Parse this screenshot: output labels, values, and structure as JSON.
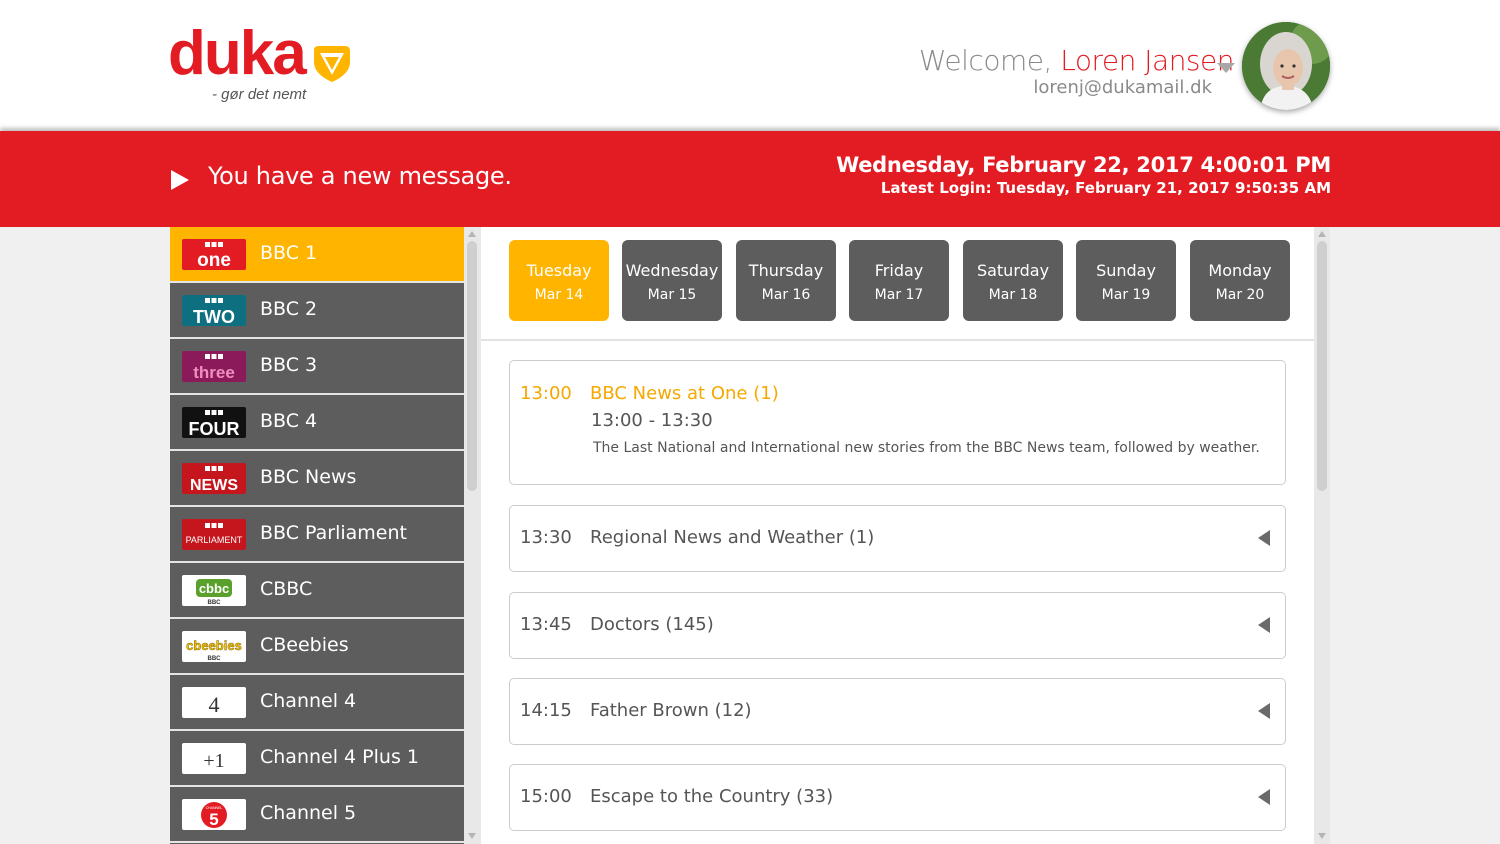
{
  "brand": {
    "logo_text": "duka",
    "tagline": "- gør det nemt",
    "colors": {
      "red": "#e31b23",
      "yellow": "#ffb400",
      "dark_gray": "#5d5d5d"
    }
  },
  "user": {
    "welcome_prefix": "Welcome, ",
    "name": "Loren Jansen",
    "email": "lorenj@dukamail.dk"
  },
  "banner": {
    "message": "You have a new message.",
    "datetime": "Wednesday, February 22, 2017 4:00:01 PM",
    "last_login": "Latest Login: Tuesday, February 21, 2017 9:50:35 AM"
  },
  "channels": [
    {
      "name": "BBC 1",
      "logo_top": "BBC",
      "logo_main": "one",
      "active": true
    },
    {
      "name": "BBC 2",
      "logo_top": "BBC",
      "logo_main": "TWO"
    },
    {
      "name": "BBC 3",
      "logo_top": "BBC",
      "logo_main": "three"
    },
    {
      "name": "BBC 4",
      "logo_top": "BBC",
      "logo_main": "FOUR"
    },
    {
      "name": "BBC News",
      "logo_top": "BBC",
      "logo_main": "NEWS"
    },
    {
      "name": "BBC Parliament",
      "logo_top": "BBC",
      "logo_main": "PARLIAMENT"
    },
    {
      "name": "CBBC",
      "logo_top": "cbbc",
      "logo_main": "BBC"
    },
    {
      "name": "CBeebies",
      "logo_top": "cbeebies",
      "logo_main": "BBC"
    },
    {
      "name": "Channel 4",
      "logo_top": "",
      "logo_main": "4"
    },
    {
      "name": "Channel 4 Plus 1",
      "logo_top": "",
      "logo_main": "+1"
    },
    {
      "name": "Channel 5",
      "logo_top": "CHANNEL",
      "logo_main": "5"
    }
  ],
  "days": [
    {
      "name": "Tuesday",
      "date": "Mar 14",
      "active": true
    },
    {
      "name": "Wednesday",
      "date": "Mar 15"
    },
    {
      "name": "Thursday",
      "date": "Mar 16"
    },
    {
      "name": "Friday",
      "date": "Mar 17"
    },
    {
      "name": "Saturday",
      "date": "Mar 18"
    },
    {
      "name": "Sunday",
      "date": "Mar 19"
    },
    {
      "name": "Monday",
      "date": "Mar 20"
    }
  ],
  "programs": [
    {
      "time": "13:00",
      "title": "BBC News at One (1)",
      "range": "13:00 - 13:30",
      "description": "The Last National and International new stories from the BBC News team, followed by weather.",
      "expanded": true
    },
    {
      "time": "13:30",
      "title": "Regional News and Weather (1)"
    },
    {
      "time": "13:45",
      "title": "Doctors (145)"
    },
    {
      "time": "14:15",
      "title": "Father  Brown (12)"
    },
    {
      "time": "15:00",
      "title": "Escape to the Country (33)"
    }
  ]
}
